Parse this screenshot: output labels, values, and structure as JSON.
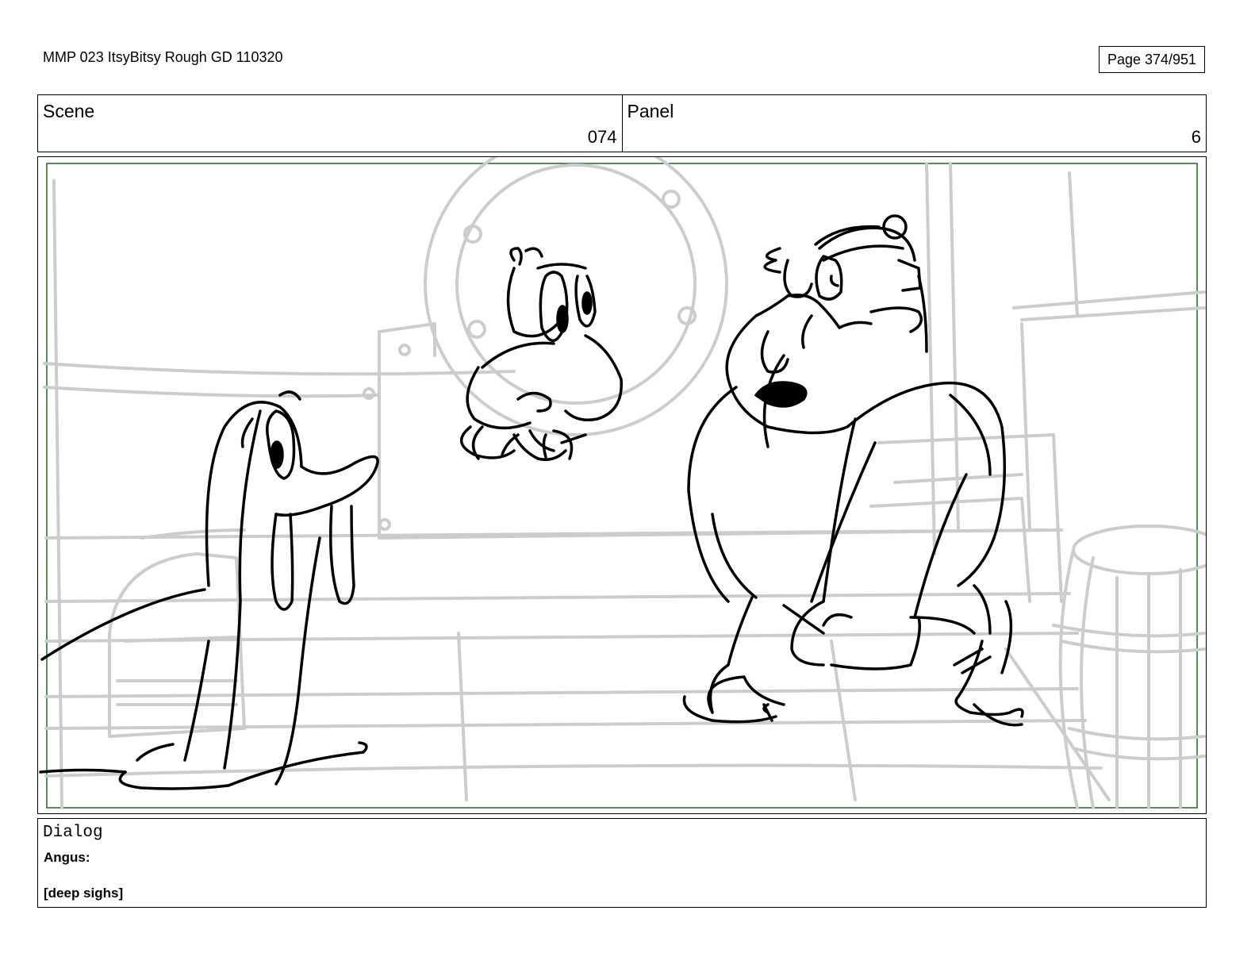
{
  "document": {
    "title": "MMP 023 ItsyBitsy Rough GD 110320",
    "page": "Page 374/951"
  },
  "header": {
    "scene_label": "Scene",
    "scene_value": "074",
    "panel_label": "Panel",
    "panel_value": "6"
  },
  "panel": {
    "frame_color": "#1a6b1a",
    "background_line_color": "#c8c8c8",
    "character_line_color": "#000000"
  },
  "dialog": {
    "label": "Dialog",
    "speaker": "Angus:",
    "text": "[deep sighs]"
  }
}
